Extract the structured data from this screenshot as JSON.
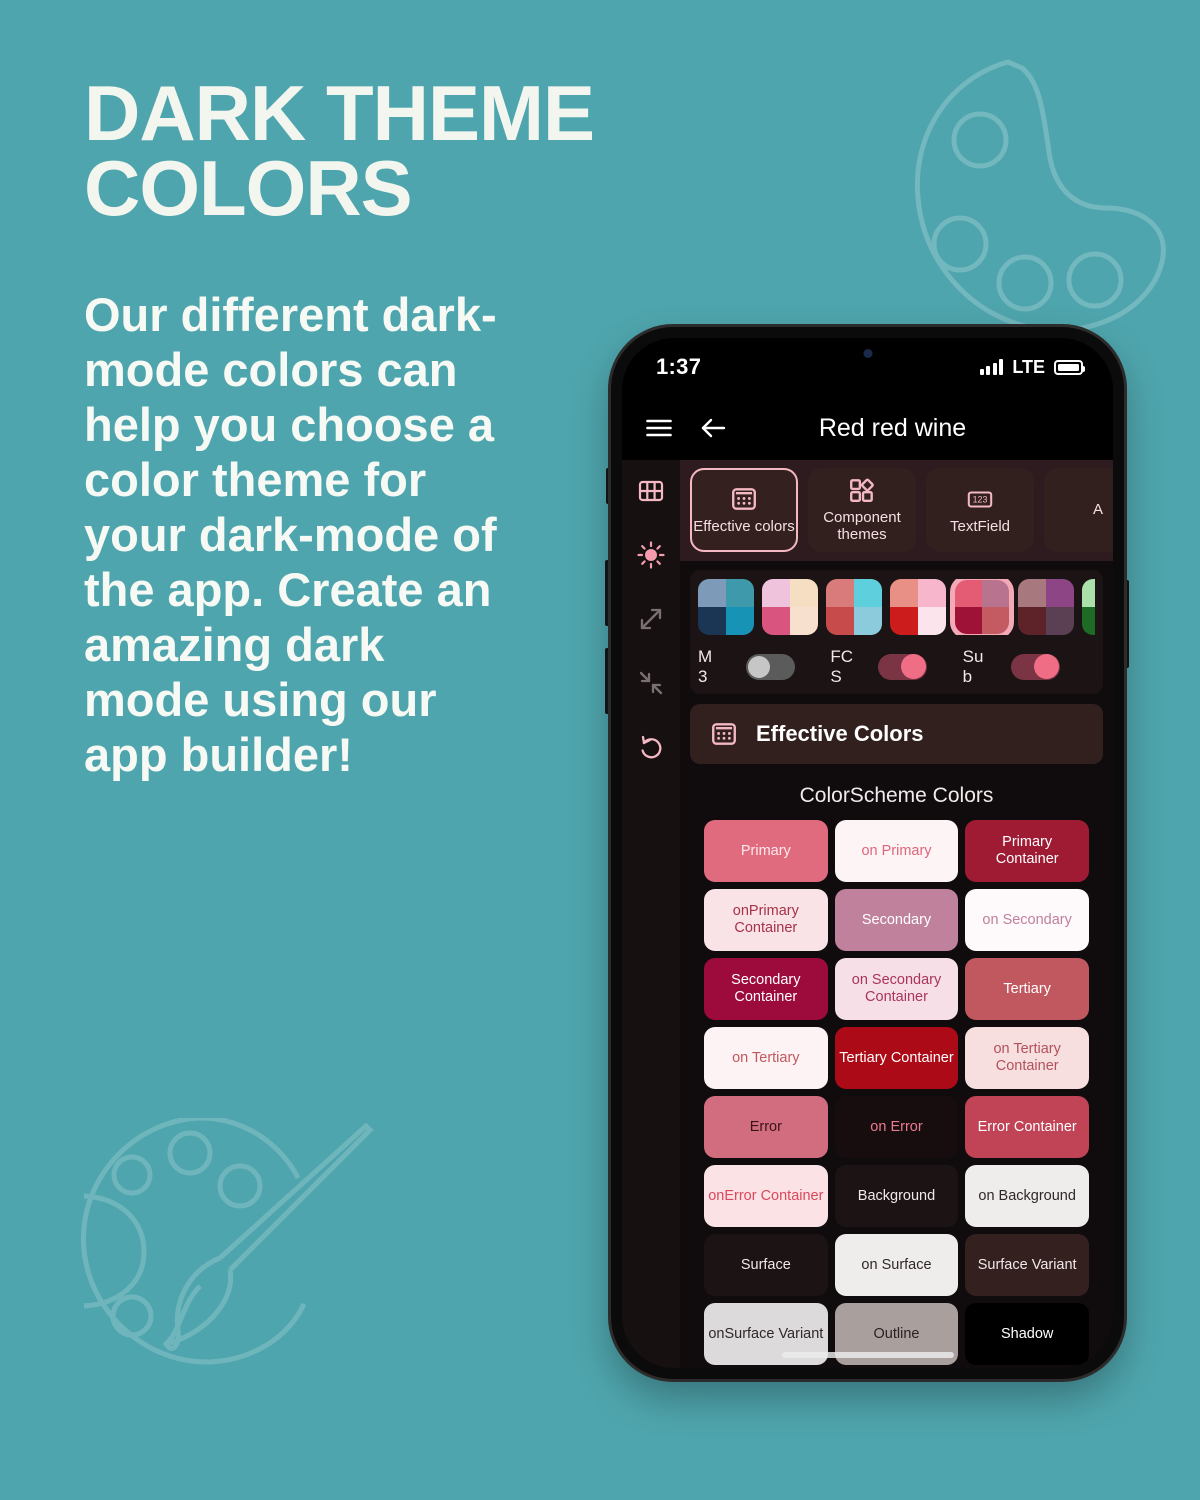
{
  "poster": {
    "background_color": "#4FA5AD",
    "headline_lines": [
      "DARK THEME",
      "COLORS"
    ],
    "body": "Our different dark-mode colors can help you choose a color theme for your dark-mode of the app. Create an amazing dark mode using our app builder!",
    "decorations": [
      {
        "name": "palette-outline-icon",
        "position": "top-right"
      },
      {
        "name": "palette-brush-icon",
        "position": "bottom-left"
      }
    ]
  },
  "phone": {
    "status_bar": {
      "time": "1:37",
      "network": "LTE",
      "signal_icon": "signal-bars-icon",
      "battery_icon": "battery-full-icon"
    },
    "app_bar": {
      "menu_icon": "hamburger-menu-icon",
      "back_icon": "arrow-left-icon",
      "title": "Red red wine"
    },
    "rail": [
      {
        "name": "grid-icon",
        "active": true
      },
      {
        "name": "brightness-sun-icon",
        "active": true
      },
      {
        "name": "expand-arrows-icon",
        "active": false
      },
      {
        "name": "collapse-arrows-icon",
        "active": false
      },
      {
        "name": "reset-undo-icon",
        "active": true
      }
    ],
    "tabs": [
      {
        "label": "Effective colors",
        "icon": "effective-colors-icon",
        "selected": true
      },
      {
        "label": "Component themes",
        "icon": "component-themes-icon",
        "selected": false
      },
      {
        "label": "TextField",
        "icon": "textfield-123-icon",
        "selected": false
      },
      {
        "label": "A",
        "icon": "partial-icon",
        "selected": false
      }
    ],
    "palette_swatches": [
      {
        "selected": false,
        "colors": [
          "#7D9AB8",
          "#3E9AAB",
          "#1B3555",
          "#1693B5"
        ]
      },
      {
        "selected": false,
        "colors": [
          "#EFC3DC",
          "#F5DEC2",
          "#D9557F",
          "#F8E0CE"
        ]
      },
      {
        "selected": false,
        "colors": [
          "#D97B7B",
          "#5ECFDC",
          "#C84B4B",
          "#8CCBDC"
        ]
      },
      {
        "selected": false,
        "colors": [
          "#E89086",
          "#F7B6CC",
          "#CD1C1C",
          "#FBE4EC"
        ]
      },
      {
        "selected": true,
        "colors": [
          "#E45C74",
          "#B8738F",
          "#9E1237",
          "#C45B63"
        ]
      },
      {
        "selected": false,
        "colors": [
          "#A8787F",
          "#8E4586",
          "#5E2328",
          "#5B4054"
        ]
      },
      {
        "selected": false,
        "colors": [
          "#ABE0AB",
          "#ABE0AB",
          "#1E6B26",
          "#1E6B26"
        ]
      }
    ],
    "toggles": [
      {
        "label": "M 3",
        "label_lines": [
          "M",
          "3"
        ],
        "state": "off"
      },
      {
        "label": "FC S",
        "label_lines": [
          "FC",
          "S"
        ],
        "state": "on"
      },
      {
        "label": "Su b",
        "label_lines": [
          "Su",
          "b"
        ],
        "state": "on"
      }
    ],
    "effective_colors_header": {
      "icon": "effective-colors-icon",
      "title": "Effective Colors"
    },
    "section_title": "ColorScheme Colors",
    "color_cards": [
      {
        "label": "Primary",
        "bg": "#E06B7F",
        "fg": "#FCE9ED"
      },
      {
        "label": "on Primary",
        "bg": "#FDF4F5",
        "fg": "#E0667C"
      },
      {
        "label": "Primary Container",
        "bg": "#9E1B33",
        "fg": "#FFFFFF"
      },
      {
        "label": "onPrimary Container",
        "bg": "#F9E3E7",
        "fg": "#A63248"
      },
      {
        "label": "Secondary",
        "bg": "#C0819C",
        "fg": "#FFFFFF"
      },
      {
        "label": "on Secondary",
        "bg": "#FEFAFC",
        "fg": "#C0819C"
      },
      {
        "label": "Secondary Container",
        "bg": "#9D0B3C",
        "fg": "#FFFFFF"
      },
      {
        "label": "on Secondary Container",
        "bg": "#F7DFE7",
        "fg": "#A8355A"
      },
      {
        "label": "Tertiary",
        "bg": "#C2585F",
        "fg": "#FFFFFF"
      },
      {
        "label": "on Tertiary",
        "bg": "#FDF3F4",
        "fg": "#C2585F"
      },
      {
        "label": "Tertiary Container",
        "bg": "#AC0A16",
        "fg": "#FFFFFF"
      },
      {
        "label": "on Tertiary Container",
        "bg": "#F7DEDF",
        "fg": "#B2525C"
      },
      {
        "label": "Error",
        "bg": "#D16D7E",
        "fg": "#3A1218"
      },
      {
        "label": "on Error",
        "bg": "#170C0E",
        "fg": "#E77C90"
      },
      {
        "label": "Error Container",
        "bg": "#C04356",
        "fg": "#FFFFFF"
      },
      {
        "label": "onError Container",
        "bg": "#FBE2E5",
        "fg": "#D9485C"
      },
      {
        "label": "Background",
        "bg": "#1C1314",
        "fg": "#F2E9EA"
      },
      {
        "label": "on Background",
        "bg": "#EFEDEC",
        "fg": "#30272A"
      },
      {
        "label": "Surface",
        "bg": "#1C1314",
        "fg": "#F2E9EA"
      },
      {
        "label": "on Surface",
        "bg": "#EFEDEC",
        "fg": "#30272A"
      },
      {
        "label": "Surface Variant",
        "bg": "#33201F",
        "fg": "#F2E9EA"
      },
      {
        "label": "onSurface Variant",
        "bg": "#DCDADA",
        "fg": "#30272A"
      },
      {
        "label": "Outline",
        "bg": "#A9A09E",
        "fg": "#2A2123"
      },
      {
        "label": "Shadow",
        "bg": "#000000",
        "fg": "#FFFFFF"
      }
    ],
    "home_indicator": "home-indicator-bar"
  }
}
